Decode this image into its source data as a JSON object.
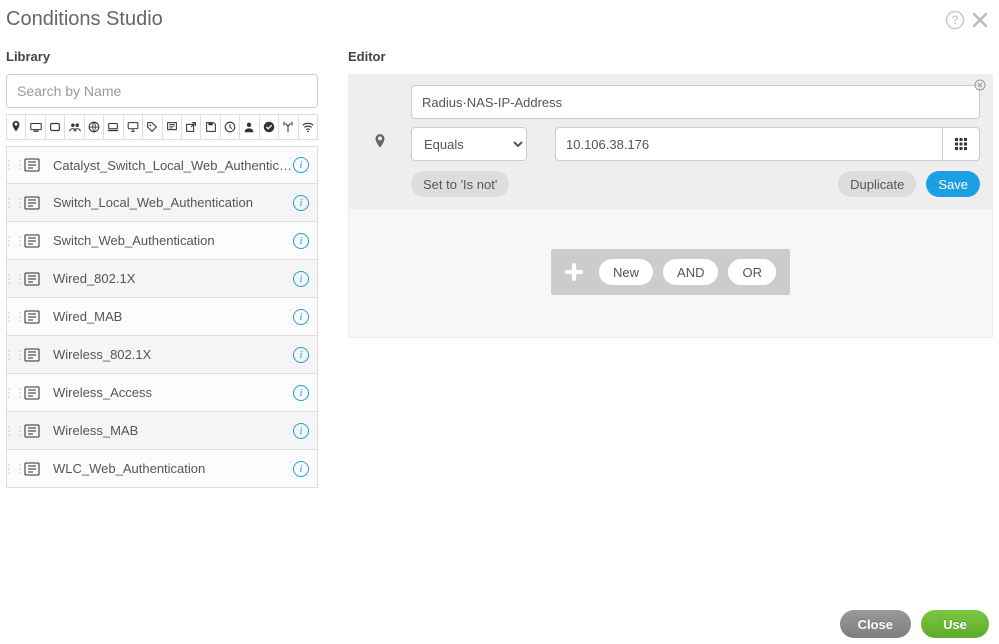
{
  "title": "Conditions Studio",
  "library": {
    "heading": "Library",
    "search_placeholder": "Search by Name",
    "items": [
      {
        "label": "Catalyst_Switch_Local_Web_Authentication"
      },
      {
        "label": "Switch_Local_Web_Authentication"
      },
      {
        "label": "Switch_Web_Authentication"
      },
      {
        "label": "Wired_802.1X"
      },
      {
        "label": "Wired_MAB"
      },
      {
        "label": "Wireless_802.1X"
      },
      {
        "label": "Wireless_Access"
      },
      {
        "label": "Wireless_MAB"
      },
      {
        "label": "WLC_Web_Authentication"
      }
    ]
  },
  "editor": {
    "heading": "Editor",
    "attribute": "Radius·NAS-IP-Address",
    "operator": "Equals",
    "value": "10.106.38.176",
    "set_to_label": "Set to 'Is not'",
    "duplicate_label": "Duplicate",
    "save_label": "Save",
    "connectors": {
      "new": "New",
      "and": "AND",
      "or": "OR"
    }
  },
  "footer": {
    "close": "Close",
    "use": "Use"
  }
}
